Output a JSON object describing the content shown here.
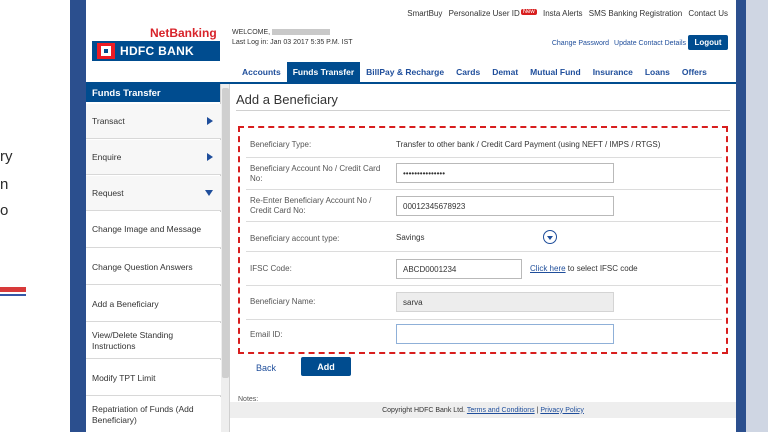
{
  "slide": {
    "fragments": [
      "ry",
      "n",
      "o"
    ]
  },
  "toplinks": {
    "items": [
      "SmartBuy",
      "Personalize User ID",
      "Insta Alerts",
      "SMS Banking Registration",
      "Contact Us"
    ],
    "new_badge": "New"
  },
  "header": {
    "brand_top": "NetBanking",
    "brand_name": "HDFC BANK",
    "welcome_label": "WELCOME,",
    "last_login": "Last Log in: Jan 03 2017 5:35 P.M. IST",
    "links": [
      "Change Password",
      "Update Contact Details"
    ],
    "logout_label": "Logout"
  },
  "nav": {
    "tabs": [
      "Accounts",
      "Funds Transfer",
      "BillPay & Recharge",
      "Cards",
      "Demat",
      "Mutual Fund",
      "Insurance",
      "Loans",
      "Offers"
    ],
    "active": "Funds Transfer"
  },
  "sidebar": {
    "header": "Funds Transfer",
    "items": [
      {
        "label": "Transact"
      },
      {
        "label": "Enquire"
      },
      {
        "label": "Request"
      },
      {
        "label": "Change Image and Message"
      },
      {
        "label": "Change Question Answers"
      },
      {
        "label": "Add a Beneficiary"
      },
      {
        "label": "View/Delete Standing Instructions"
      },
      {
        "label": "Modify TPT Limit"
      },
      {
        "label": "Repatriation of Funds (Add Beneficiary)"
      }
    ]
  },
  "content": {
    "title": "Add a Beneficiary",
    "form": {
      "beneficiary_type_label": "Beneficiary Type:",
      "beneficiary_type_value": "Transfer to other bank / Credit Card Payment (using NEFT / IMPS / RTGS)",
      "account_no_label": "Beneficiary Account No / Credit Card No:",
      "account_no_value": "•••••••••••••••",
      "reenter_label": "Re-Enter Beneficiary Account No / Credit Card No:",
      "reenter_value": "00012345678923",
      "account_type_label": "Beneficiary account type:",
      "account_type_value": "Savings",
      "ifsc_label": "IFSC Code:",
      "ifsc_value": "ABCD0001234",
      "ifsc_link": "Click here",
      "ifsc_link_suffix": " to select IFSC code",
      "name_label": "Beneficiary Name:",
      "name_value": "sarva",
      "email_label": "Email ID:",
      "email_value": ""
    },
    "back_label": "Back",
    "add_label": "Add",
    "notes_label": "Notes:"
  },
  "footer": {
    "copyright": "Copyright HDFC Bank Ltd.",
    "terms": "Terms and Conditions",
    "separator": "|",
    "privacy": "Privacy Policy"
  },
  "colors": {
    "brand_blue": "#004c8f",
    "brand_red": "#d8232a",
    "dashed_red": "#d81e1e"
  }
}
